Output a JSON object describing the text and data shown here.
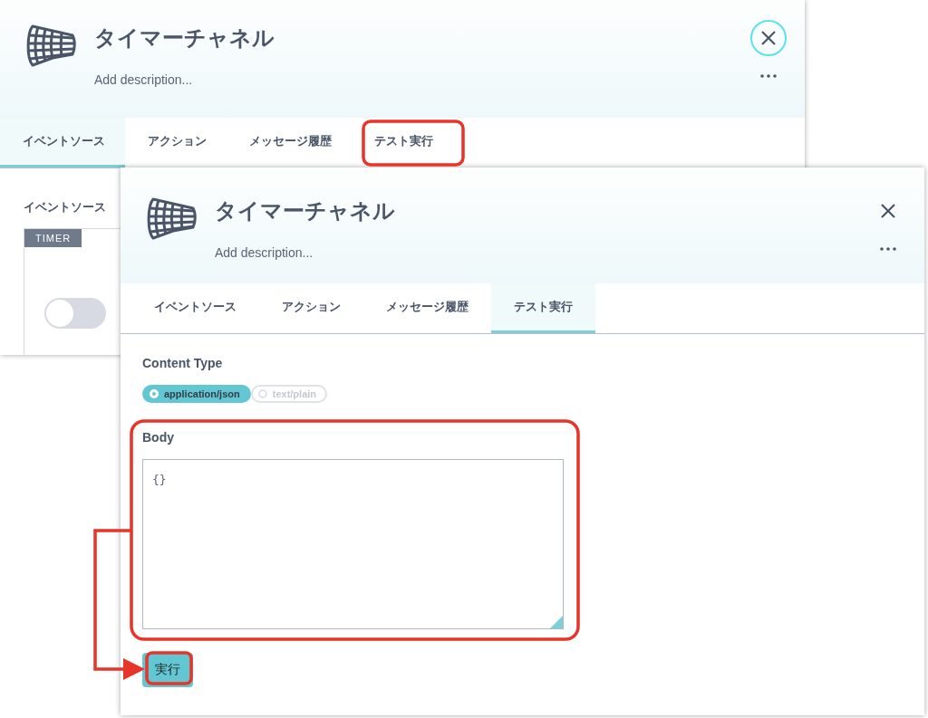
{
  "windows": [
    {
      "kind": "event_source",
      "title": "タイマーチャネル",
      "description": "Add description...",
      "close": {
        "focused": true
      },
      "tabs": [
        {
          "label": "イベントソース",
          "selected": true
        },
        {
          "label": "アクション",
          "selected": false
        },
        {
          "label": "メッセージ履歴",
          "selected": false
        },
        {
          "label": "テスト実行",
          "selected": false
        }
      ],
      "section_title": "イベントソース",
      "card": {
        "badge": "TIMER",
        "toggle": {
          "on": false
        }
      }
    },
    {
      "kind": "test_run",
      "title": "タイマーチャネル",
      "description": "Add description...",
      "close": {
        "focused": false
      },
      "tabs": [
        {
          "label": "イベントソース",
          "selected": false
        },
        {
          "label": "アクション",
          "selected": false
        },
        {
          "label": "メッセージ履歴",
          "selected": false
        },
        {
          "label": "テスト実行",
          "selected": true
        }
      ],
      "content_type": {
        "label": "Content Type",
        "options": [
          {
            "label": "application/json",
            "selected": true
          },
          {
            "label": "text/plain",
            "selected": false
          }
        ]
      },
      "body": {
        "label": "Body",
        "value": "{}"
      },
      "run_button": "実行"
    }
  ]
}
